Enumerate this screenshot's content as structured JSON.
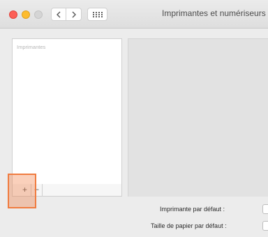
{
  "window": {
    "title": "Imprimantes et numériseurs"
  },
  "toolbar": {
    "back_icon": "chevron-left-icon",
    "forward_icon": "chevron-right-icon",
    "show_all_icon": "grid-icon"
  },
  "printer_list": {
    "header": "Imprimantes",
    "add_label": "+",
    "remove_label": "−"
  },
  "settings": {
    "default_printer_label": "Imprimante par défaut :",
    "default_paper_size_label": "Taille de papier par défaut :"
  },
  "colors": {
    "highlight": "#f07b3f",
    "close": "#fc5f57",
    "minimize": "#fdbc2e",
    "zoom_disabled": "#d5d5d5"
  }
}
